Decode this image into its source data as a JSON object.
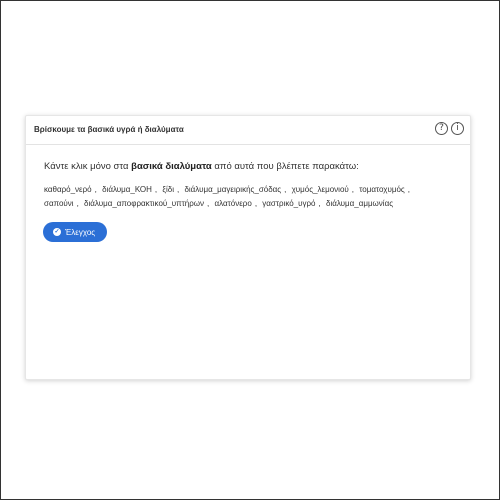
{
  "card": {
    "title": "Βρίσκουμε τα βασικά υγρά ή διαλύματα",
    "help_icon": "question-circle-icon",
    "info_icon": "info-circle-icon",
    "help_glyph": "?",
    "info_glyph": "i"
  },
  "instruction": {
    "before": "Κάντε κλικ μόνο στα ",
    "bold": "βασικά διαλύματα",
    "after": " από αυτά που βλέπετε παρακάτω:"
  },
  "items": [
    "καθαρό_νερό",
    "διάλυμα_ΚΟΗ",
    "ξίδι",
    "διάλυμα_μαγειρικής_σόδας",
    "χυμός_λεμονιού",
    "τοματοχυμός",
    "σαπούνι",
    "διάλυμα_αποφρακτικού_υπτήρων",
    "αλατόνερο",
    "γαστρικό_υγρό",
    "διάλυμα_αμμωνίας"
  ],
  "separator": ",",
  "check_button": {
    "label": "Έλεγχος",
    "icon": "check-circle-icon",
    "color": "#2b6fd6"
  }
}
